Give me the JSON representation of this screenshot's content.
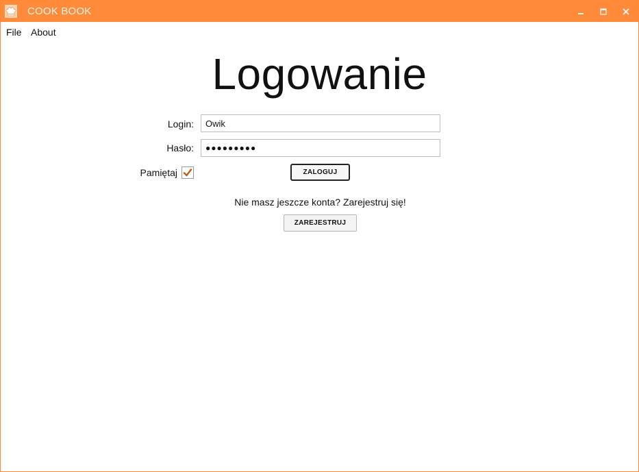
{
  "window": {
    "title": "COOK BOOK",
    "accent_color": "#ff8a3a",
    "app_icon": "chef-hat-icon",
    "controls": {
      "minimize": "minimize-icon",
      "maximize": "maximize-icon",
      "close": "close-icon"
    }
  },
  "menu": {
    "file": "File",
    "about": "About"
  },
  "form": {
    "title": "Logowanie",
    "login_label": "Login:",
    "login_value": "Owik",
    "password_label": "Hasło:",
    "password_mask": "●●●●●●●●●",
    "remember_label": "Pamiętaj",
    "remember_checked": true,
    "login_button": "ZALOGUJ"
  },
  "register": {
    "prompt": "Nie masz jeszcze konta? Zarejestruj się!",
    "button": "ZAREJESTRUJ"
  }
}
